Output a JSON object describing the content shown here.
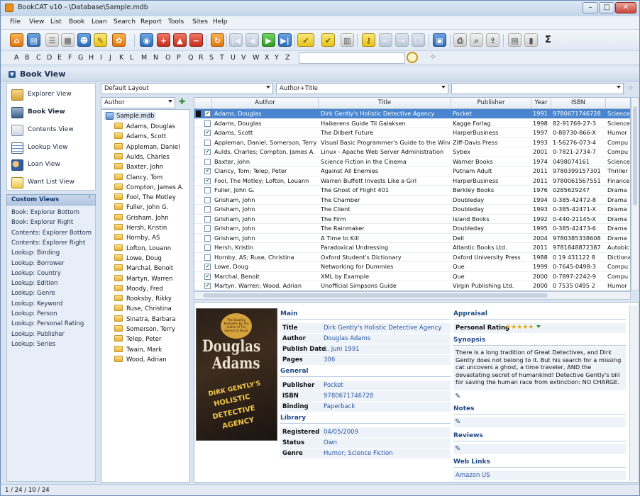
{
  "window": {
    "title": "BookCAT v10 - \\Database\\Sample.mdb",
    "min": "–",
    "max": "□",
    "close": "✕"
  },
  "menu": [
    "File",
    "View",
    "List",
    "Book",
    "Loan",
    "Search",
    "Report",
    "Tools",
    "Sites",
    "Help"
  ],
  "alphabet": [
    "A",
    "B",
    "C",
    "D",
    "E",
    "F",
    "G",
    "H",
    "I",
    "J",
    "K",
    "L",
    "M",
    "N",
    "O",
    "P",
    "Q",
    "R",
    "S",
    "T",
    "U",
    "V",
    "W",
    "X",
    "Y",
    "Z"
  ],
  "view_header": "Book View",
  "nav": {
    "items": [
      {
        "label": "Explorer View",
        "icon": "explorer-icon"
      },
      {
        "label": "Book View",
        "icon": "book-icon"
      },
      {
        "label": "Contents View",
        "icon": "contents-icon"
      },
      {
        "label": "Lookup View",
        "icon": "lookup-icon"
      },
      {
        "label": "Loan View",
        "icon": "loan-icon"
      },
      {
        "label": "Want List View",
        "icon": "want-list-icon"
      }
    ]
  },
  "custom_views": {
    "title": "Custom Views",
    "collapse": "˄",
    "items": [
      "Book: Explorer Bottom",
      "Book: Explorer Right",
      "Contents: Explorer Bottom",
      "Contents: Explorer Right",
      "Lookup: Binding",
      "Lookup: Borrower",
      "Lookup: Country",
      "Lookup: Edition",
      "Lookup: Genre",
      "Lookup: Keyword",
      "Lookup: Person",
      "Lookup: Personal Rating",
      "Lookup: Publisher",
      "Lookup: Series"
    ]
  },
  "layout": {
    "combo": "Default Layout",
    "sort": "Author+Title",
    "filter": ""
  },
  "tree": {
    "header": "Author",
    "root": "Sample.mdb",
    "nodes": [
      "Adams, Douglas",
      "Adams, Scott",
      "Appleman, Daniel",
      "Aulds, Charles",
      "Baxter, John",
      "Clancy, Tom",
      "Compton, James A.",
      "Fool, The Motley",
      "Fuller, John G.",
      "Grisham, John",
      "Hersh, Kristin",
      "Hornby, AS",
      "Lofton, Louann",
      "Lowe, Doug",
      "Marchal, Benoit",
      "Martyn, Warren",
      "Moody, Fred",
      "Rooksby, Rikky",
      "Ruse, Christina",
      "Sinatra, Barbara",
      "Somerson, Terry",
      "Telep, Peter",
      "Twain, Mark",
      "Wood, Adrian"
    ]
  },
  "grid": {
    "columns": [
      "Author",
      "Title",
      "Publisher",
      "Year",
      "ISBN",
      ""
    ],
    "rows": [
      {
        "checked": true,
        "author": "Adams, Douglas",
        "title": "Dirk Gently's Holistic Detective Agency",
        "publisher": "Pocket",
        "year": "1991",
        "isbn": "9780671746728",
        "genre": "Science"
      },
      {
        "checked": false,
        "author": "Adams, Douglas",
        "title": "Haikerens Guide Til Galaksen",
        "publisher": "Kagge Forlag",
        "year": "1998",
        "isbn": "82-91769-27-3",
        "genre": "Science"
      },
      {
        "checked": true,
        "author": "Adams, Scott",
        "title": "The Dilbert Future",
        "publisher": "HarperBusiness",
        "year": "1997",
        "isbn": "0-88730-866-X",
        "genre": "Humor"
      },
      {
        "checked": false,
        "author": "Appleman, Daniel; Somerson, Terry (E",
        "title": "Visual Basic Programmer's Guide to the Windo",
        "publisher": "Ziff-Davis Press",
        "year": "1993",
        "isbn": "1-56276-073-4",
        "genre": "Compu"
      },
      {
        "checked": true,
        "author": "Aulds, Charles; Compton, James A. (E",
        "title": "Linux - Apache Web Server Administration",
        "publisher": "Sybex",
        "year": "2001",
        "isbn": "0-7821-2734-7",
        "genre": "Compu"
      },
      {
        "checked": false,
        "author": "Baxter, John",
        "title": "Science Fiction in the Cinema",
        "publisher": "Warner Books",
        "year": "1974",
        "isbn": "0498074161",
        "genre": "Science"
      },
      {
        "checked": true,
        "author": "Clancy, Tom; Telep, Peter",
        "title": "Against All Enemies",
        "publisher": "Putnam Adult",
        "year": "2011",
        "isbn": "9780399157301",
        "genre": "Thriller"
      },
      {
        "checked": true,
        "author": "Fool, The Motley; Lofton, Louann",
        "title": "Warren Buffett Invests Like a Girl",
        "publisher": "HarperBusiness",
        "year": "2011",
        "isbn": "9780061567551",
        "genre": "Finance"
      },
      {
        "checked": false,
        "author": "Fuller, John G.",
        "title": "The Ghost of Flight 401",
        "publisher": "Berkley Books",
        "year": "1976",
        "isbn": "0285629247",
        "genre": "Drama"
      },
      {
        "checked": false,
        "author": "Grisham, John",
        "title": "The Chamber",
        "publisher": "Doubleday",
        "year": "1994",
        "isbn": "0-385-42472-8",
        "genre": "Drama"
      },
      {
        "checked": false,
        "author": "Grisham, John",
        "title": "The Client",
        "publisher": "Doubleday",
        "year": "1993",
        "isbn": "0-385-42471-X",
        "genre": "Drama"
      },
      {
        "checked": false,
        "author": "Grisham, John",
        "title": "The Firm",
        "publisher": "Island Books",
        "year": "1992",
        "isbn": "0-440-21145-X",
        "genre": "Drama"
      },
      {
        "checked": false,
        "author": "Grisham, John",
        "title": "The Rainmaker",
        "publisher": "Doubleday",
        "year": "1995",
        "isbn": "0-385-42473-6",
        "genre": "Drama"
      },
      {
        "checked": false,
        "author": "Grisham, John",
        "title": "A Time to Kill",
        "publisher": "Dell",
        "year": "2004",
        "isbn": "9780385338608",
        "genre": "Drama"
      },
      {
        "checked": false,
        "author": "Hersh, Kristin",
        "title": "Paradoxical Undressing",
        "publisher": "Atlantic Books Ltd.",
        "year": "2011",
        "isbn": "9781848872387",
        "genre": "Autobic"
      },
      {
        "checked": false,
        "author": "Hornby, AS; Ruse, Christina",
        "title": "Oxford Student's Dictionary",
        "publisher": "Oxford University Press",
        "year": "1988",
        "isbn": "0 19 431122 8",
        "genre": "Dictiona"
      },
      {
        "checked": true,
        "author": "Lowe, Doug",
        "title": "Networking for Dummies",
        "publisher": "Que",
        "year": "1999",
        "isbn": "0-7645-0498-3",
        "genre": "Compu"
      },
      {
        "checked": true,
        "author": "Marchal, Benoit",
        "title": "XML by Example",
        "publisher": "Que",
        "year": "2000",
        "isbn": "0-7897-2242-9",
        "genre": "Compu"
      },
      {
        "checked": true,
        "author": "Martyn, Warren; Wood, Adrian",
        "title": "Unofficial Simpsons Guide",
        "publisher": "Virgin Publishing Ltd.",
        "year": "2000",
        "isbn": "0 7535 0495 2",
        "genre": "Humor"
      }
    ]
  },
  "cover": {
    "line1": "Douglas",
    "line2": "Adams",
    "line3": "DIRK GENTLY'S",
    "line4": "HOLISTIC",
    "line5": "DETECTIVE",
    "line6": "AGENCY",
    "badge": "The Dazzling Bestseller By The Author of The Salmon of Doubt"
  },
  "detail": {
    "main": {
      "title": "Main",
      "fields": [
        {
          "k": "Title",
          "v": "Dirk Gently's Holistic Detective Agency"
        },
        {
          "k": "Author",
          "v": "Douglas Adams"
        },
        {
          "k": "Publish Date",
          "v": "1. juni 1991"
        },
        {
          "k": "Pages",
          "v": "306"
        }
      ]
    },
    "general": {
      "title": "General",
      "fields": [
        {
          "k": "Publisher",
          "v": "Pocket"
        },
        {
          "k": "ISBN",
          "v": "9780671746728"
        },
        {
          "k": "Binding",
          "v": "Paperback"
        }
      ]
    },
    "library": {
      "title": "Library",
      "fields": [
        {
          "k": "Registered",
          "v": "04/05/2009"
        },
        {
          "k": "Status",
          "v": "Own"
        },
        {
          "k": "Genre",
          "v": "Humor; Science Fiction"
        }
      ]
    },
    "appraisal": {
      "title": "Appraisal",
      "rating_label": "Personal Rating",
      "rating": 5
    },
    "synopsis": {
      "title": "Synopsis",
      "text": "There is a long tradition of Great Detectives, and Dirk Gently does not belong to it. But his search for a missing cat uncovers a ghost, a time traveler, AND the devastating secret of humankind! Detective Gently's bill for saving the human race from extinction: NO CHARGE."
    },
    "notes": "Notes",
    "reviews": "Reviews",
    "weblinks": {
      "title": "Web Links",
      "link": "Amazon US"
    }
  },
  "status": "1 / 24 / 10 / 24"
}
